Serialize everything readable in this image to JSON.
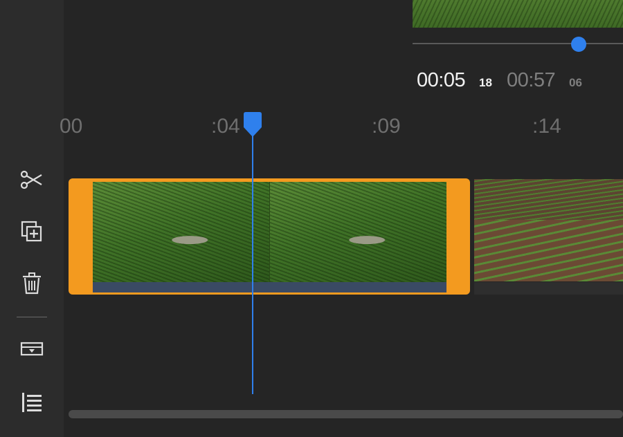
{
  "toolbar": {
    "tools": [
      {
        "name": "split",
        "icon": "scissors-icon"
      },
      {
        "name": "duplicate",
        "icon": "duplicate-icon"
      },
      {
        "name": "delete",
        "icon": "trash-icon"
      },
      {
        "name": "track",
        "icon": "track-expand-icon"
      },
      {
        "name": "list",
        "icon": "align-list-icon"
      }
    ]
  },
  "playback": {
    "current_time": "00:05",
    "current_frame": "18",
    "total_time": "00:57",
    "total_frame": "06",
    "seek_fraction": 0.79
  },
  "ruler": {
    "ticks": [
      "00",
      ":04",
      ":09",
      ":14"
    ]
  },
  "colors": {
    "accent": "#2f80ed",
    "selection": "#f39a1f",
    "background": "#252525",
    "sidebar": "#2c2c2c"
  }
}
